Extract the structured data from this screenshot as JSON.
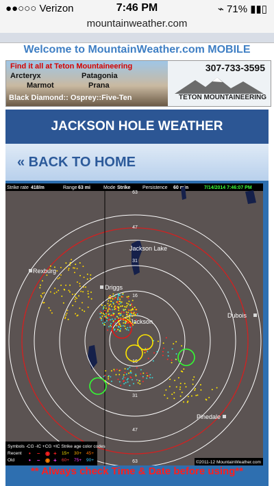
{
  "status": {
    "carrier": "●●○○○ Verizon",
    "time": "7:46 PM",
    "battery": "71%"
  },
  "url": "mountainweather.com",
  "welcome": "Welcome to MountainWeather.com MOBILE",
  "ad": {
    "find_text": "Find it all at Teton Mountaineering",
    "brands": [
      "Arcteryx",
      "Patagonia",
      "Marmot",
      "Prana",
      "Black Diamond:: Osprey::Five-Ten"
    ],
    "phone": "307-733-3595",
    "store": "TETON MOUNTAINEERING"
  },
  "page_title": "JACKSON HOLE WEATHER",
  "back_link": "« BACK TO HOME",
  "map": {
    "header": {
      "strike_rate_label": "Strike rate",
      "strike_rate_value": "418/m",
      "range_label": "Range",
      "range_value": "63 mi",
      "mode_label": "Mode",
      "mode_value": "Strike",
      "persistence_label": "Persistence",
      "persistence_value": "60 min",
      "datetime": "7/14/2014 7:46:07 PM"
    },
    "ring_labels": [
      "63",
      "47",
      "31",
      "16",
      "16",
      "31",
      "47",
      "63"
    ],
    "places": [
      "Jackson Lake",
      "Rexburg",
      "Driggs",
      "Jackson",
      "Dubois",
      "Pinedale"
    ],
    "legend": {
      "row1": "Symbols -CG -IC +CG +IC  Strike age color codes",
      "recent_label": "Recent",
      "old_label": "Old",
      "recent_ages": [
        "15+",
        "30+",
        "45+"
      ],
      "old_ages": [
        "60+",
        "75+",
        "90+"
      ]
    },
    "copyright": "©2011-12 MountainWeather.com",
    "colors": {
      "bg": "#5b5352",
      "ring": "#ffffff",
      "range_ring": "#d42020"
    }
  },
  "warning": "** Always check Time & Date before using**"
}
